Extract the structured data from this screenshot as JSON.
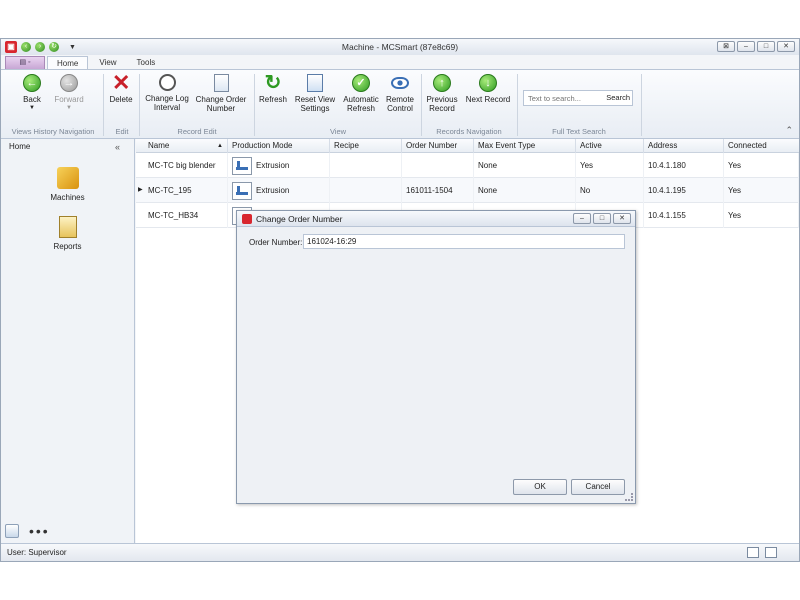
{
  "window": {
    "title": "Machine - MCSmart (87e8c69)",
    "controls": [
      "⊠",
      "–",
      "□",
      "✕"
    ]
  },
  "quick_access": {
    "caret": "▼"
  },
  "tabs": {
    "app_button": "▤ ◦",
    "items": [
      "Home",
      "View",
      "Tools"
    ]
  },
  "ribbon": {
    "back": "Back",
    "back_caret": "▼",
    "forward": "Forward",
    "forward_caret": "▼",
    "delete": "Delete",
    "change_log_interval": [
      "Change Log",
      "Interval"
    ],
    "change_order_number": [
      "Change Order",
      "Number"
    ],
    "refresh": "Refresh",
    "reset_view_settings": [
      "Reset View",
      "Settings"
    ],
    "automatic_refresh": [
      "Automatic",
      "Refresh"
    ],
    "remote_control": [
      "Remote",
      "Control"
    ],
    "previous_record": [
      "Previous",
      "Record"
    ],
    "next_record": "Next Record",
    "search_placeholder": "Text to search...",
    "search_button": "Search",
    "groups": {
      "views_history": "Views History Navigation",
      "edit": "Edit",
      "record_edit": "Record Edit",
      "view": "View",
      "records_navigation": "Records Navigation",
      "full_text_search": "Full Text Search"
    },
    "collapse": "⌃"
  },
  "sidebar": {
    "title": "Home",
    "collapse": "«",
    "items": [
      "Machines",
      "Reports"
    ],
    "more": "•••"
  },
  "grid": {
    "columns": [
      "Name",
      "Production Mode",
      "Recipe",
      "Order Number",
      "Max Event Type",
      "Active",
      "Address",
      "Connected"
    ],
    "sort_indicator": "▲",
    "current_row_marker": "▶",
    "rows": [
      {
        "name": "MC-TC big blender",
        "mode": "Extrusion",
        "recipe": "",
        "order": "",
        "max_event": "None",
        "active": "Yes",
        "address": "10.4.1.180",
        "connected": "Yes"
      },
      {
        "name": "MC-TC_195",
        "mode": "Extrusion",
        "recipe": "",
        "order": "161011-1504",
        "max_event": "None",
        "active": "No",
        "address": "10.4.1.195",
        "connected": "Yes"
      },
      {
        "name": "MC-TC_HB34",
        "mode": "",
        "recipe": "",
        "order": "",
        "max_event": "",
        "active": "",
        "address": "10.4.1.155",
        "connected": "Yes"
      }
    ]
  },
  "dialog": {
    "title": "Change Order Number",
    "controls": [
      "–",
      "□",
      "✕"
    ],
    "label": "Order Number:",
    "value": "161024-16:29",
    "ok": "OK",
    "cancel": "Cancel"
  },
  "status": {
    "user": "User: Supervisor"
  }
}
